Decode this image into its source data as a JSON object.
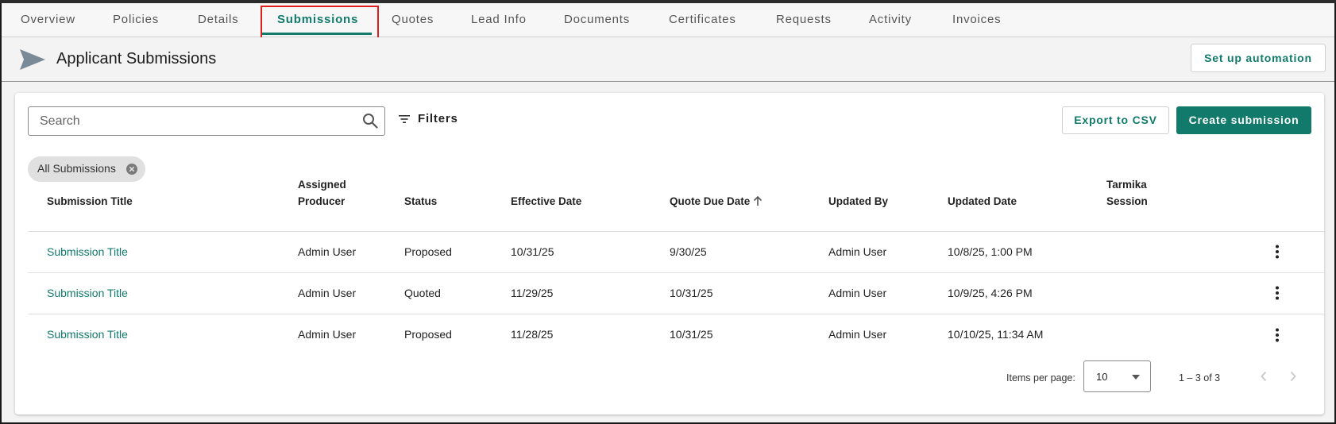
{
  "tabs": [
    {
      "label": "Overview"
    },
    {
      "label": "Policies"
    },
    {
      "label": "Details"
    },
    {
      "label": "Submissions",
      "active": true
    },
    {
      "label": "Quotes"
    },
    {
      "label": "Lead Info"
    },
    {
      "label": "Documents"
    },
    {
      "label": "Certificates"
    },
    {
      "label": "Requests"
    },
    {
      "label": "Activity"
    },
    {
      "label": "Invoices"
    }
  ],
  "header": {
    "title": "Applicant Submissions",
    "automation_button": "Set up automation",
    "icon": "send-icon"
  },
  "toolbar": {
    "search_placeholder": "Search",
    "search_value": "",
    "filters_label": "Filters",
    "export_button": "Export to CSV",
    "create_button": "Create submission"
  },
  "chip": {
    "label": "All Submissions"
  },
  "table": {
    "headers": {
      "title": "Submission Title",
      "producer_line1": "Assigned",
      "producer_line2": "Producer",
      "status": "Status",
      "effective": "Effective Date",
      "quote_due": "Quote Due Date",
      "updated_by": "Updated By",
      "updated_date": "Updated Date",
      "session_line1": "Tarmika",
      "session_line2": "Session"
    },
    "sort": {
      "column": "quote_due",
      "direction": "ascending"
    },
    "rows": [
      {
        "title": "Submission Title",
        "producer": "Admin User",
        "status": "Proposed",
        "effective": "10/31/25",
        "quote_due": "9/30/25",
        "updated_by": "Admin User",
        "updated_date": "10/8/25, 1:00 PM",
        "session": ""
      },
      {
        "title": "Submission Title",
        "producer": "Admin User",
        "status": "Quoted",
        "effective": "11/29/25",
        "quote_due": "10/31/25",
        "updated_by": "Admin User",
        "updated_date": "10/9/25, 4:26 PM",
        "session": ""
      },
      {
        "title": "Submission Title",
        "producer": "Admin User",
        "status": "Proposed",
        "effective": "11/28/25",
        "quote_due": "10/31/25",
        "updated_by": "Admin User",
        "updated_date": "10/10/25, 11:34 AM",
        "session": ""
      }
    ]
  },
  "pagination": {
    "items_per_page_label": "Items per page:",
    "items_per_page": "10",
    "range": "1 – 3 of 3"
  },
  "colors": {
    "accent": "#117a6b",
    "highlight": "#e01e1e",
    "icon_gray": "#7a8a96"
  }
}
